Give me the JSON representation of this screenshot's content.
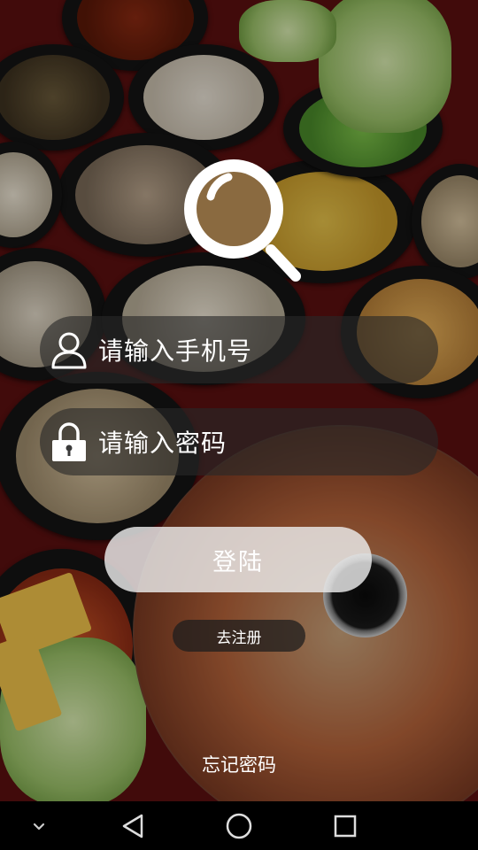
{
  "login": {
    "phone_placeholder": "请输入手机号",
    "password_placeholder": "请输入密码",
    "login_label": "登陆",
    "register_label": "去注册",
    "forgot_label": "忘记密码"
  },
  "icons": {
    "logo": "search-icon",
    "phone_field": "user-icon",
    "password_field": "lock-icon",
    "nav": [
      "chevron-down-icon",
      "back-triangle-icon",
      "home-circle-icon",
      "recents-square-icon"
    ]
  },
  "colors": {
    "field_bg": "#282828",
    "button_bg": "#ebebeb",
    "text": "#ffffff",
    "navbar_bg": "#000000"
  }
}
